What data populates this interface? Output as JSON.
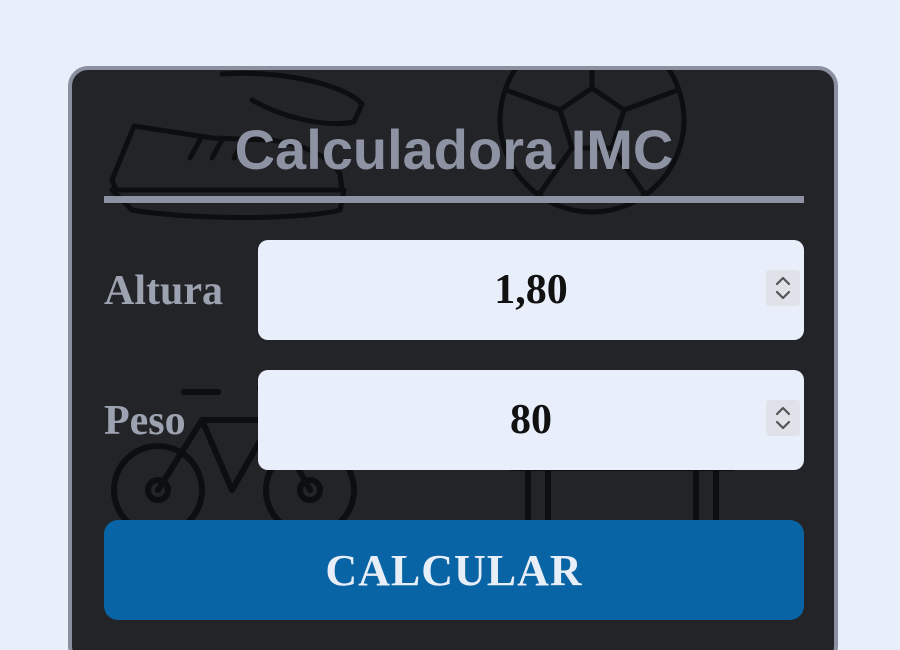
{
  "calculator": {
    "title": "Calculadora IMC",
    "fields": {
      "altura": {
        "label": "Altura",
        "value": "1,80"
      },
      "peso": {
        "label": "Peso",
        "value": "80"
      }
    },
    "button_label": "CALCULAR"
  },
  "icons": {
    "background": [
      "sneaker-icon",
      "soccer-ball-icon",
      "bicycle-icon",
      "bench-icon"
    ],
    "field_control": "spinner-arrows-icon"
  },
  "colors": {
    "page_background": "#e8effb",
    "card_background": "#222428",
    "card_border": "#8a90a0",
    "title_text": "#8e93a4",
    "input_background": "#e8effb",
    "button_background": "#0864a4",
    "button_text": "#e8eef8"
  }
}
